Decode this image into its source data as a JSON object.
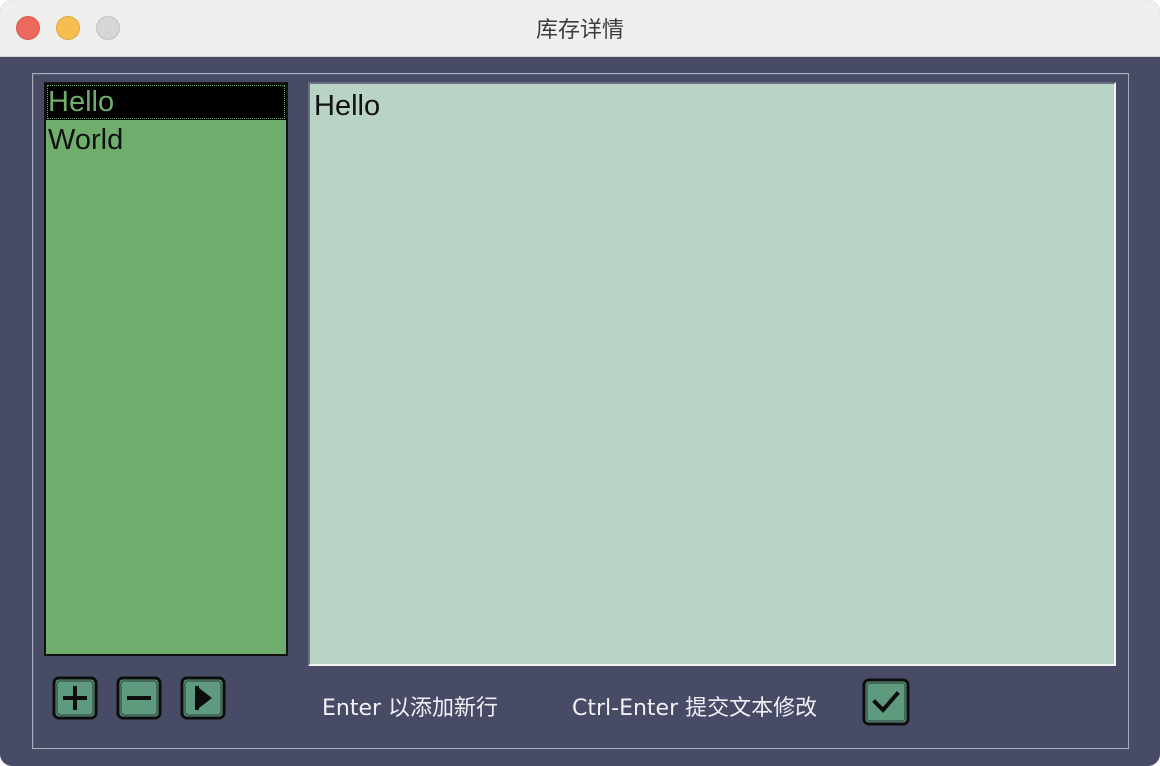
{
  "window": {
    "title": "库存详情"
  },
  "list": {
    "items": [
      {
        "label": "Hello",
        "selected": true
      },
      {
        "label": "World",
        "selected": false
      }
    ]
  },
  "editor": {
    "text": "Hello"
  },
  "toolbar": {
    "add_icon": "plus-icon",
    "remove_icon": "minus-icon",
    "run_icon": "play-icon",
    "submit_icon": "check-icon"
  },
  "hints": {
    "enter": "Enter 以添加新行",
    "ctrl_enter": "Ctrl-Enter 提交文本修改"
  },
  "colors": {
    "background": "#474b66",
    "list_background": "#6fae6d",
    "editor_background": "#b9d4c4",
    "button_fill": "#5d9a7e",
    "selection": "#000000"
  }
}
